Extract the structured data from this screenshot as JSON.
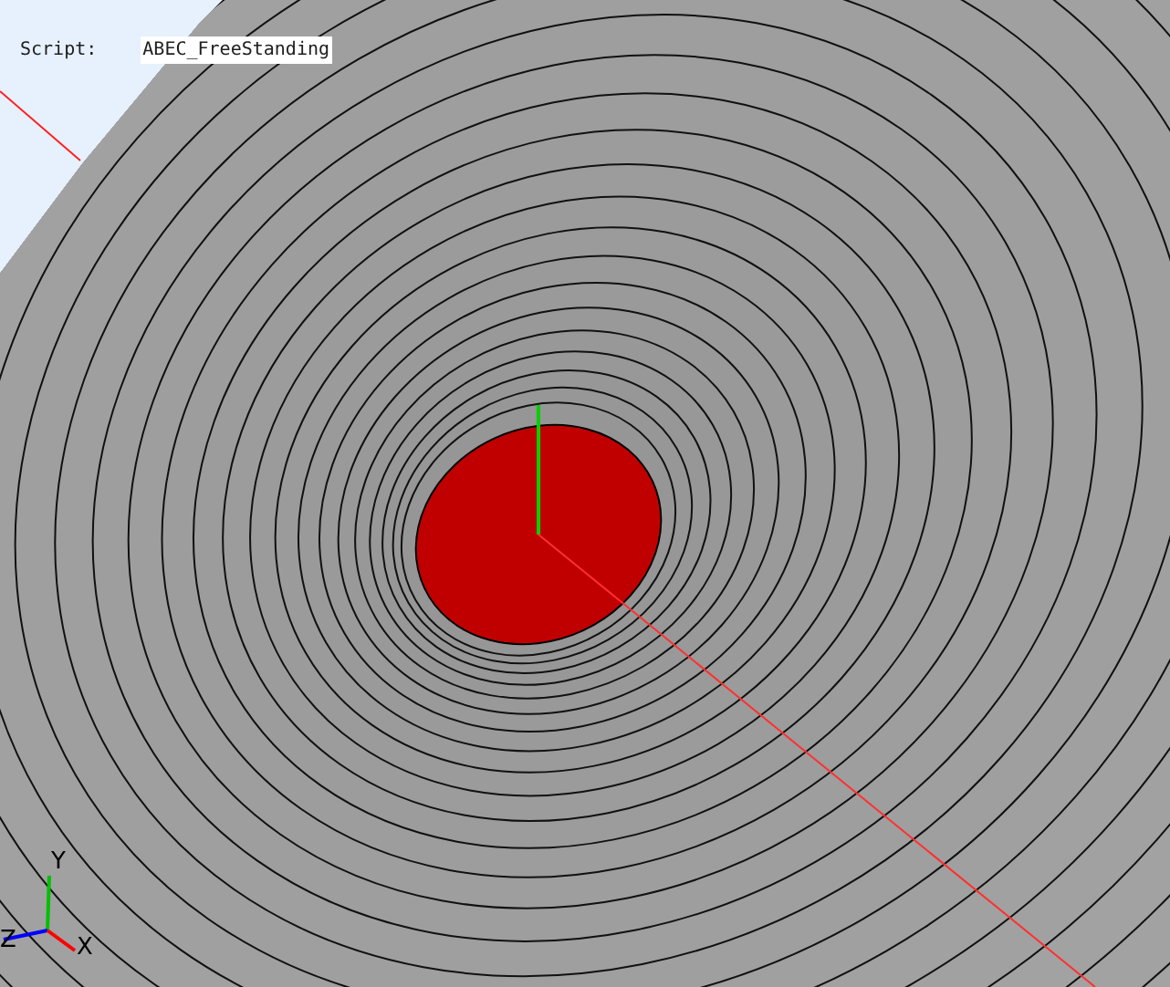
{
  "viewport": {
    "script_label": "Script:",
    "script_name": "ABEC_FreeStanding"
  },
  "axes": {
    "x": "X",
    "y": "Y",
    "z": "Z"
  }
}
